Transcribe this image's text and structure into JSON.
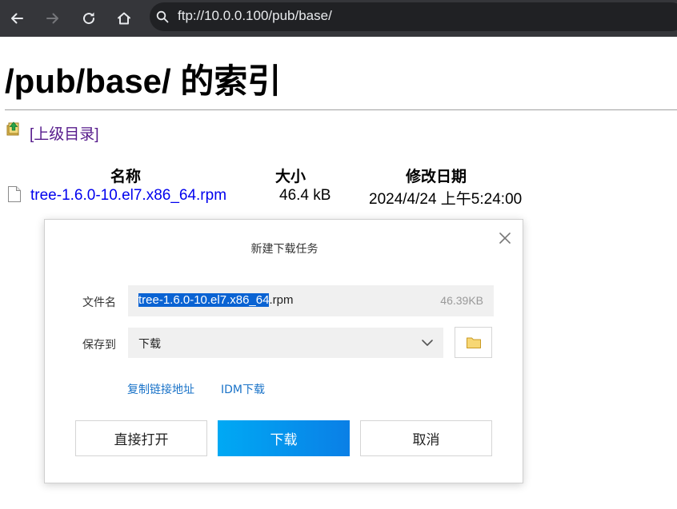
{
  "browser": {
    "address": "ftp://10.0.0.100/pub/base/"
  },
  "page": {
    "title": "/pub/base/ 的索引",
    "parent_link": "[上级目录]",
    "columns": {
      "name": "名称",
      "size": "大小",
      "modified": "修改日期"
    },
    "files": [
      {
        "name": "tree-1.6.0-10.el7.x86_64.rpm",
        "size": "46.4 kB",
        "modified": "2024/4/24 上午5:24:00"
      }
    ]
  },
  "dialog": {
    "title": "新建下载任务",
    "filename_label": "文件名",
    "filename_selected": "tree-1.6.0-10.el7.x86_64",
    "filename_ext": ".rpm",
    "file_size": "46.39KB",
    "save_label": "保存到",
    "save_location": "下载",
    "copy_link": "复制链接地址",
    "idm_download": "IDM下载",
    "open_button": "直接打开",
    "download_button": "下载",
    "cancel_button": "取消"
  },
  "colors": {
    "toolbar_bg": "#35363a",
    "omnibox_bg": "#202124",
    "visited_link": "#551a8b",
    "link": "#0000ee",
    "download_accent": "#0a7fe6",
    "selection": "#0a63d3"
  }
}
